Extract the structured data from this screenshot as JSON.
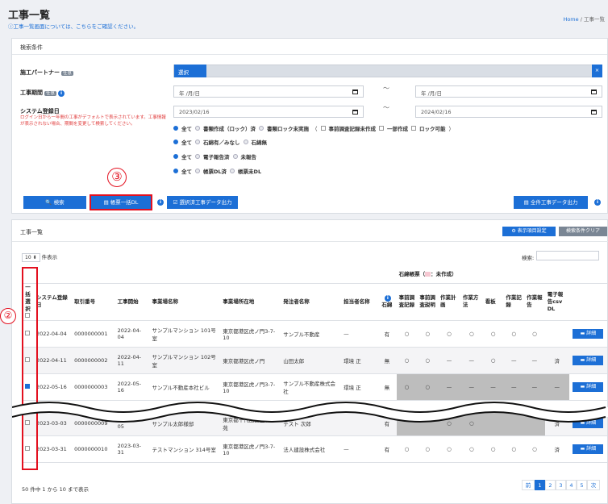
{
  "page": {
    "title": "工事一覧",
    "help": "ⓘ工事一覧画面については、こちらをご確認ください。",
    "crumb_home": "Home",
    "crumb_sep": "/",
    "crumb_current": "工事一覧"
  },
  "search": {
    "heading": "検索条件",
    "partner_label": "施工パートナー",
    "badge": "任意",
    "partner_select": "選択",
    "partner_clear": "×",
    "period_label": "工事期間",
    "period_from_placeholder": "年 /月/日",
    "period_to_placeholder": "年 /月/日",
    "tilde": "〜",
    "reg_label": "システム登録日",
    "reg_note": "ログイン日から一年間の工事がデフォルトで表示されています。工事情報が表示されない場合、期間を変更して検索してください。",
    "reg_from": "2023/02/16",
    "reg_to": "2024/02/16",
    "row1": [
      "全て",
      "書類作成（ロック）済",
      "書類ロック未実施",
      "（",
      "事前調査記録未作成",
      "一部作成",
      "ロック可能",
      "）"
    ],
    "row2": [
      "全て",
      "石綿有／みなし",
      "石綿無"
    ],
    "row3": [
      "全て",
      "電子報告済",
      "未報告"
    ],
    "row4": [
      "全て",
      "帳票DL済",
      "帳票未DL"
    ],
    "btn_search": "検索",
    "btn_bulk": "帳票一括DL",
    "btn_export_selected": "選択済工事データ出力",
    "btn_export_all": "全件工事データ出力",
    "marker3": "③",
    "marker2": "②"
  },
  "list": {
    "heading": "工事一覧",
    "btn_cols": "表示項目設定",
    "btn_clear": "検索条件クリア",
    "page_size": "10",
    "page_size_suffix": "件表示",
    "search_label": "検索:",
    "header_group": "石綿帳票（",
    "header_group_mid": "：未作成）",
    "headers": {
      "select": "一括選択",
      "reg": "システム登録日",
      "no": "取引番号",
      "start": "工事開始",
      "site": "事業場名称",
      "addr": "事業場所在地",
      "client": "発注者名称",
      "staff": "担当者名称",
      "asb": "石綿",
      "pre_rec": "事前調査記録",
      "pre_exp": "事前調査説明",
      "plan": "作業計画",
      "method": "作業方法",
      "board": "看板",
      "rec": "作業記録",
      "report": "作業報告",
      "e_report": "電子報告csv DL"
    },
    "detail": "詳細",
    "rows": [
      {
        "checked": false,
        "reg": "2022-04-04",
        "no": "0000000001",
        "start": "2022-04-04",
        "site": "サンプルマンション 101号室",
        "addr": "東京都港区虎ノ門3-7-10",
        "client": "サンプル不動産",
        "staff": "—",
        "asb": "有",
        "m": [
          "○",
          "○",
          "○",
          "○",
          "○",
          "○",
          "○"
        ],
        "er": ""
      },
      {
        "checked": false,
        "reg": "2022-04-11",
        "no": "0000000002",
        "start": "2022-04-11",
        "site": "サンプルマンション 102号室",
        "addr": "東京都港区虎ノ門",
        "client": "山田太郎",
        "staff": "環境 正",
        "asb": "無",
        "m": [
          "○",
          "○",
          "—",
          "—",
          "○",
          "—",
          "—"
        ],
        "er": "済"
      },
      {
        "checked": true,
        "reg": "2022-05-16",
        "no": "0000000003",
        "start": "2022-05-16",
        "site": "サンプル不動産本社ビル",
        "addr": "東京都港区虎ノ門3-7-10",
        "client": "サンプル不動産株式会社",
        "staff": "環境 正",
        "asb": "無",
        "m": [
          "○",
          "○",
          "—",
          "—",
          "—",
          "—",
          "—"
        ],
        "er": "—"
      },
      {
        "checked": false,
        "reg": "2023-03-03",
        "no": "0000000009",
        "start": "2023-03-05",
        "site": "サンプル太郎様邸",
        "addr": "東京都千代田区皇居外苑",
        "client": "テスト 次郎",
        "staff": "",
        "asb": "有",
        "m": [
          "",
          "",
          "○",
          "○",
          "",
          "",
          ""
        ],
        "er": "済"
      },
      {
        "checked": false,
        "reg": "2023-03-31",
        "no": "0000000010",
        "start": "2023-03-31",
        "site": "テストマンション 314号室",
        "addr": "東京都港区虎ノ門3-7-10",
        "client": "法人建設株式会社",
        "staff": "—",
        "asb": "有",
        "m": [
          "○",
          "○",
          "○",
          "○",
          "○",
          "○",
          "○"
        ],
        "er": "済"
      }
    ],
    "summary": "50 件中 1 から 10 まで表示",
    "prev": "前",
    "pages": [
      "1",
      "2",
      "3",
      "4",
      "5"
    ],
    "next": "次"
  }
}
